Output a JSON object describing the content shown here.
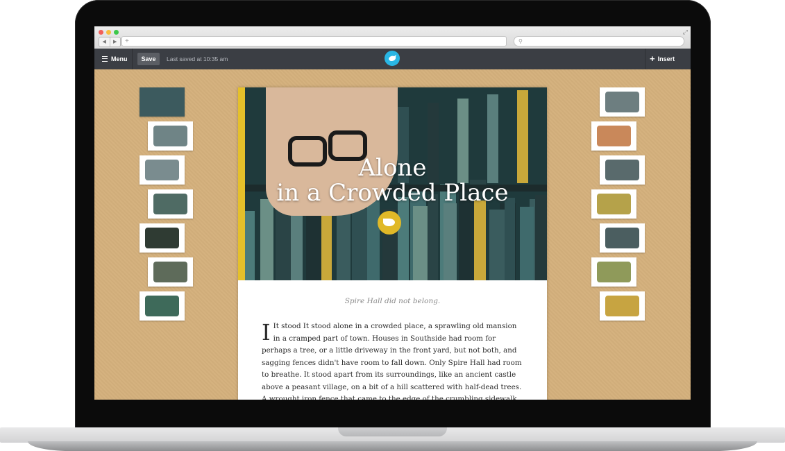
{
  "toolbar": {
    "menu_label": "Menu",
    "save_label": "Save",
    "last_saved": "Last saved at 10:35 am",
    "insert_label": "Insert"
  },
  "story": {
    "title_line1": "Alone",
    "title_line2": "in a Crowded Place",
    "subtitle": "Spire Hall did not belong.",
    "dropcap": "I",
    "body": "It stood It stood alone in a crowded place, a sprawling old mansion in a cramped part of town. Houses in Southside had room for perhaps a tree, or a little driveway in the front yard, but not both, and sagging fences didn't have room to fall down. Only Spire Hall had room to breathe. It stood apart from its surroundings, like an ancient castle above a peasant village, on a bit of a hill scattered with half-dead trees. A wrought iron fence that came to the edge of the crumbling sidewalk, kept the crowded little world of Southside at"
  },
  "colors": {
    "toolbar": "#3b3e44",
    "workspace": "#d4b07c",
    "accent_yellow": "#e5c02a",
    "logo_blue": "#29b6e4"
  },
  "thumbnails_left": [
    {
      "name": "thumb-girl-bookshelf",
      "color": "#3c5a5e",
      "selected": true
    },
    {
      "name": "thumb-crystal-ball",
      "color": "#6f8486"
    },
    {
      "name": "thumb-desk-scene",
      "color": "#7a8c8f"
    },
    {
      "name": "thumb-library-room",
      "color": "#4f6b64"
    },
    {
      "name": "thumb-dark-window",
      "color": "#2f3b33"
    },
    {
      "name": "thumb-stacked-books",
      "color": "#5e6b5a"
    },
    {
      "name": "thumb-globe",
      "color": "#3e6a5a"
    }
  ],
  "thumbnails_right": [
    {
      "name": "thumb-machinery",
      "color": "#6d7e80"
    },
    {
      "name": "thumb-autumn-tree",
      "color": "#c9885a"
    },
    {
      "name": "thumb-bats-tower",
      "color": "#596a6c"
    },
    {
      "name": "thumb-portrait-frame",
      "color": "#b5a24a"
    },
    {
      "name": "thumb-bare-trees",
      "color": "#4b5e60"
    },
    {
      "name": "thumb-old-woman",
      "color": "#8f9a5a"
    },
    {
      "name": "thumb-book-pages",
      "color": "#c7a441"
    }
  ]
}
